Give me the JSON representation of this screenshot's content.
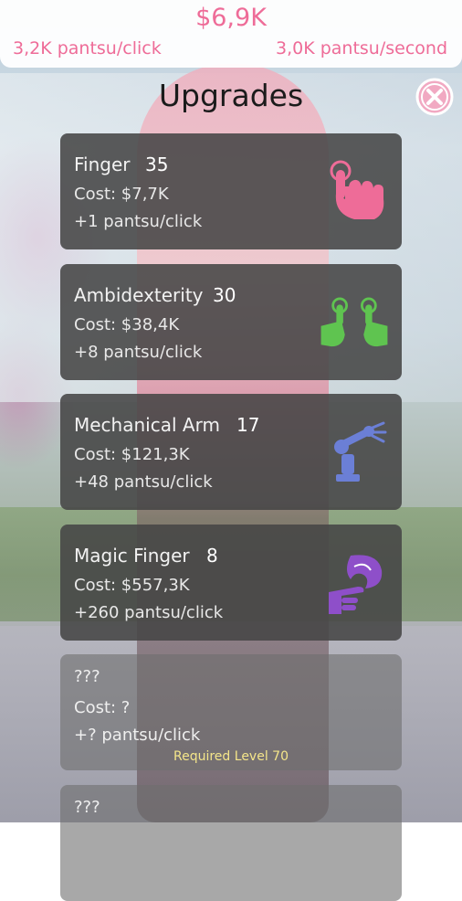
{
  "header": {
    "money": "$6,9K",
    "per_click": "3,2K pantsu/click",
    "per_second": "3,0K pantsu/second"
  },
  "panel": {
    "title": "Upgrades"
  },
  "upgrades": [
    {
      "name": "Finger",
      "level": "35",
      "cost": "Cost: $7,7K",
      "gain": "+1 pantsu/click",
      "icon": "pointing-finger-icon"
    },
    {
      "name": "Ambidexterity",
      "level": "30",
      "cost": "Cost: $38,4K",
      "gain": "+8 pantsu/click",
      "icon": "two-hands-icon"
    },
    {
      "name": "Mechanical Arm",
      "level": "17",
      "cost": "Cost: $121,3K",
      "gain": "+48 pantsu/click",
      "icon": "robot-arm-icon"
    },
    {
      "name": "Magic Finger",
      "level": "8",
      "cost": "Cost: $557,3K",
      "gain": "+260 pantsu/click",
      "icon": "magic-hand-icon"
    },
    {
      "name": "???",
      "cost": "Cost: ?",
      "gain": "+? pantsu/click",
      "requirement": "Required Level 70"
    },
    {
      "name": "???"
    }
  ],
  "colors": {
    "accent_pink": "#ee6c98",
    "card_bg": "#464646",
    "requirement_text": "#f4e58a",
    "ambidexterity_icon": "#5fc450",
    "mech_arm_icon": "#6b7fd6",
    "magic_icon": "#8e4fc9"
  }
}
